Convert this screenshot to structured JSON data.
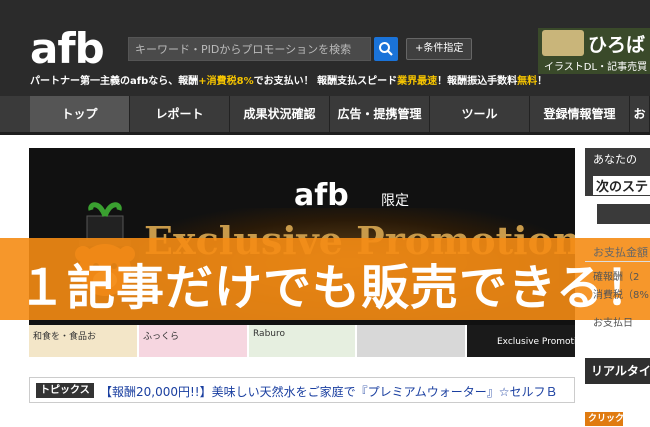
{
  "header": {
    "logo": "afb",
    "search_placeholder": "キーワード・PIDからプロモーションを検索",
    "condition_button": "+条件指定",
    "tagline_1": "パートナー第一主義のafbなら、報酬",
    "tagline_2": "+消費税8%",
    "tagline_3": "でお支払い！ 報酬支払スピード",
    "tagline_4": "業界最速",
    "tagline_5": "！報酬振込手数料",
    "tagline_6": "無料",
    "tagline_7": "！",
    "ad_big": "ひろば",
    "ad_small": "イラストDL・記事売買"
  },
  "nav": {
    "items": [
      "トップ",
      "レポート",
      "成果状況確認",
      "広告・提携管理",
      "ツール",
      "登録情報管理",
      "お"
    ]
  },
  "promo": {
    "brand": "afb",
    "limited": "限定",
    "title": "Exclusive Promotion",
    "overlay": "１記事だけでも販売できる！"
  },
  "thumbs": [
    {
      "text": "和食を・食品お"
    },
    {
      "text": "ふっくら"
    },
    {
      "text": "Raburo"
    },
    {
      "text": ""
    },
    {
      "text": "Exclusive Promotion"
    }
  ],
  "topics": {
    "label": "トピックス",
    "news": "【報酬20,000円!!】美味しい天然水をご家庭で『プレミアムウォーター』☆セルフＢ"
  },
  "sidebar": {
    "head_a": "あなたの",
    "head_b": "次のステ",
    "pay_label": "お支払金額",
    "reward": "確報酬（2",
    "tax": "消費税（8%",
    "date": "お支払日",
    "realtime": "リアルタイ",
    "click": "クリック数"
  },
  "colors": {
    "header_bg": "#2b2b2b",
    "accent_blue": "#1a73d9",
    "accent_orange": "#f58c14",
    "highlight_yellow": "#f5c400"
  }
}
